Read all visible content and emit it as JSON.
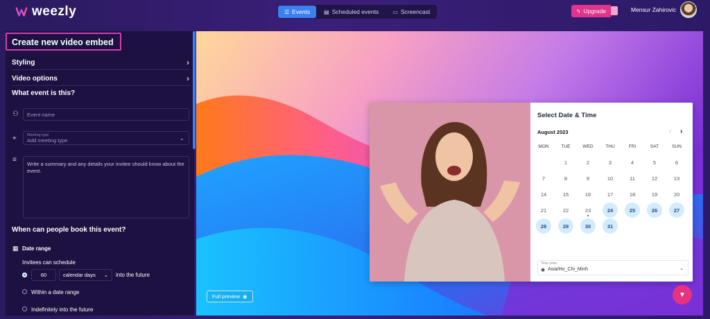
{
  "app": {
    "name": "weezly"
  },
  "nav": [
    {
      "label": "Events",
      "icon": "list-icon",
      "active": true
    },
    {
      "label": "Scheduled events",
      "icon": "calendar-icon",
      "active": false
    },
    {
      "label": "Screencast",
      "icon": "video-icon",
      "active": false
    }
  ],
  "header": {
    "upgrade_label": "Upgrade",
    "user_name": "Mensur Zahirovic"
  },
  "panel": {
    "title": "Create new video embed",
    "sections": {
      "styling": "Styling",
      "video_options": "Video options",
      "what_event": "What event is this?"
    },
    "event_name_placeholder": "Event name",
    "meeting_type_label": "Meeting type",
    "meeting_type_placeholder": "Add meeting type",
    "description_placeholder": "Write a summary and any details your invitee should know about the event.",
    "when_title": "When can people book this event?",
    "date_range_title": "Date range",
    "invitees_label": "Invitees can schedule",
    "days_value": "60",
    "days_unit": "calendar days",
    "into_future": "into the future",
    "option_within": "Within a date range",
    "option_indefinitely": "Indefinitely into the future"
  },
  "preview": {
    "full_preview_label": "Full preview",
    "calendar": {
      "title": "Select Date & Time",
      "month": "August 2023",
      "weekdays": [
        "MON",
        "TUE",
        "WED",
        "THU",
        "FRI",
        "SAT",
        "SUN"
      ],
      "first_weekday_index": 1,
      "days_in_month": 31,
      "available_days": [
        24,
        25,
        26,
        27,
        28,
        29,
        30,
        31
      ],
      "today": 23,
      "timezone_label": "Time zone",
      "timezone_value": "Asia/Ho_Chi_Minh"
    }
  },
  "colors": {
    "accent": "#3b7ff0",
    "upgrade": "#e0338c",
    "fab": "#e6337f",
    "highlight_border": "#d93bb0"
  }
}
